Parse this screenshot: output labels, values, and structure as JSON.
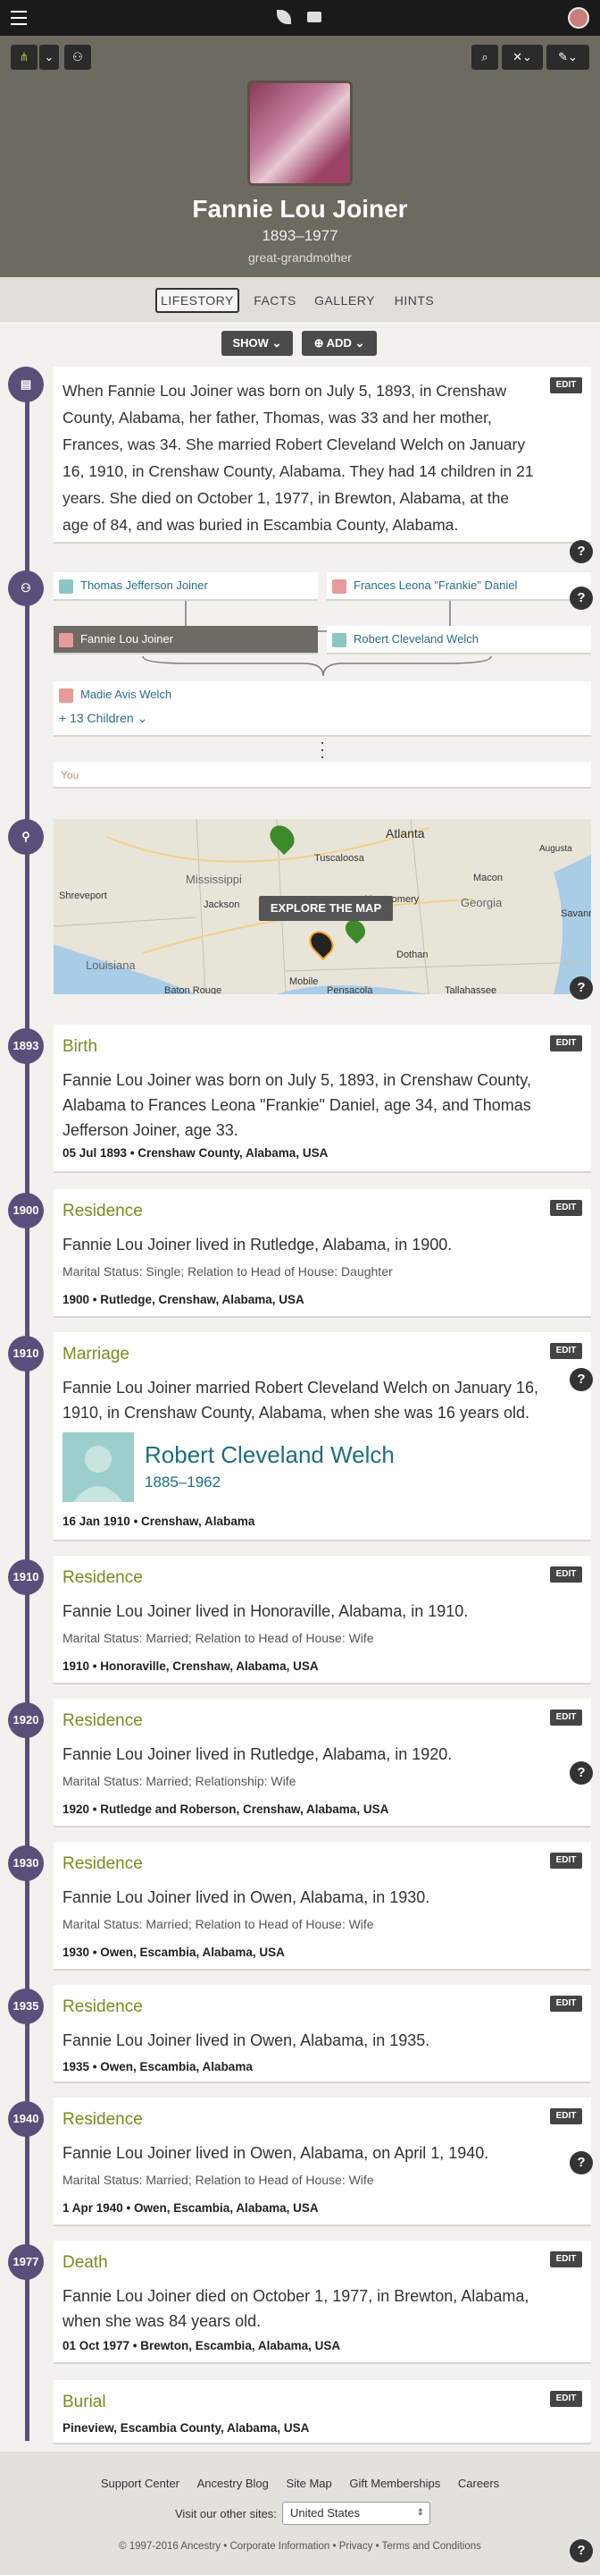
{
  "hero": {
    "name": "Fannie Lou Joiner",
    "dates": "1893–1977",
    "relation": "great-grandmother"
  },
  "tabs": [
    "LIFESTORY",
    "FACTS",
    "GALLERY",
    "HINTS"
  ],
  "actions": {
    "show": "SHOW",
    "add": "ADD"
  },
  "intro": "When Fannie Lou Joiner was born on July 5, 1893, in Crenshaw County, Alabama, her father, Thomas, was 33 and her mother, Frances, was 34. She married Robert Cleveland Welch on January 16, 1910, in Crenshaw County, Alabama. They had 14 children in 21 years. She died on October 1, 1977, in Brewton, Alabama, at the age of 84, and was buried in Escambia County, Alabama.",
  "edit_label": "EDIT",
  "help_label": "?",
  "family": {
    "father": "Thomas Jefferson Joiner",
    "mother": "Frances Leona \"Frankie\" Daniel",
    "self": "Fannie Lou Joiner",
    "spouse": "Robert Cleveland Welch",
    "child": "Madie Avis Welch",
    "more_children": "+ 13 Children",
    "you": "You"
  },
  "map": {
    "explore": "EXPLORE THE MAP",
    "places": [
      "Atlanta",
      "Augusta",
      "Tuscaloosa",
      "Mississippi",
      "Shreveport",
      "Jackson",
      "Montgomery",
      "Georgia",
      "Macon",
      "Savannah",
      "Louisiana",
      "Dothan",
      "Mobile",
      "Baton Rouge",
      "Pensacola",
      "Tallahassee"
    ]
  },
  "events": [
    {
      "year": "1893",
      "type": "Birth",
      "text": "Fannie Lou Joiner was born on July 5, 1893, in Crenshaw County, Alabama to Frances Leona \"Frankie\" Daniel, age 34, and Thomas Jefferson Joiner, age 33.",
      "detail": "",
      "meta": "05 Jul 1893 • Crenshaw County, Alabama, USA"
    },
    {
      "year": "1900",
      "type": "Residence",
      "text": "Fannie Lou Joiner lived in Rutledge, Alabama, in 1900.",
      "detail": "Marital Status: Single; Relation to Head of House: Daughter",
      "meta": "1900 • Rutledge, Crenshaw, Alabama, USA"
    },
    {
      "year": "1910",
      "type": "Marriage",
      "text": "Fannie Lou Joiner married Robert Cleveland Welch on January 16, 1910, in Crenshaw County, Alabama, when she was 16 years old.",
      "detail": "",
      "meta": "16 Jan 1910 • Crenshaw, Alabama",
      "spouse_name": "Robert Cleveland Welch",
      "spouse_dates": "1885–1962"
    },
    {
      "year": "1910",
      "type": "Residence",
      "text": "Fannie Lou Joiner lived in Honoraville, Alabama, in 1910.",
      "detail": "Marital Status: Married; Relation to Head of House: Wife",
      "meta": "1910 • Honoraville, Crenshaw, Alabama, USA"
    },
    {
      "year": "1920",
      "type": "Residence",
      "text": "Fannie Lou Joiner lived in Rutledge, Alabama, in 1920.",
      "detail": "Marital Status: Married; Relationship: Wife",
      "meta": "1920 • Rutledge and Roberson, Crenshaw, Alabama, USA"
    },
    {
      "year": "1930",
      "type": "Residence",
      "text": "Fannie Lou Joiner lived in Owen, Alabama, in 1930.",
      "detail": "Marital Status: Married; Relation to Head of House: Wife",
      "meta": "1930 • Owen, Escambia, Alabama, USA"
    },
    {
      "year": "1935",
      "type": "Residence",
      "text": "Fannie Lou Joiner lived in Owen, Alabama, in 1935.",
      "detail": "",
      "meta": "1935 • Owen, Escambia, Alabama"
    },
    {
      "year": "1940",
      "type": "Residence",
      "text": "Fannie Lou Joiner lived in Owen, Alabama, on April 1, 1940.",
      "detail": "Marital Status: Married; Relation to Head of House: Wife",
      "meta": "1 Apr 1940 • Owen, Escambia, Alabama, USA"
    },
    {
      "year": "1977",
      "type": "Death",
      "text": "Fannie Lou Joiner died on October 1, 1977, in Brewton, Alabama, when she was 84 years old.",
      "detail": "",
      "meta": "01 Oct 1977 • Brewton, Escambia, Alabama, USA"
    },
    {
      "year": "",
      "type": "Burial",
      "text": "",
      "detail": "",
      "meta": "Pineview, Escambia County, Alabama, USA"
    }
  ],
  "footer": {
    "links": [
      "Support Center",
      "Ancestry Blog",
      "Site Map",
      "Gift Memberships",
      "Careers"
    ],
    "other_sites_label": "Visit our other sites:",
    "country": "United States",
    "copyright": "© 1997-2016 Ancestry • Corporate Information • Privacy • Terms and Conditions"
  }
}
